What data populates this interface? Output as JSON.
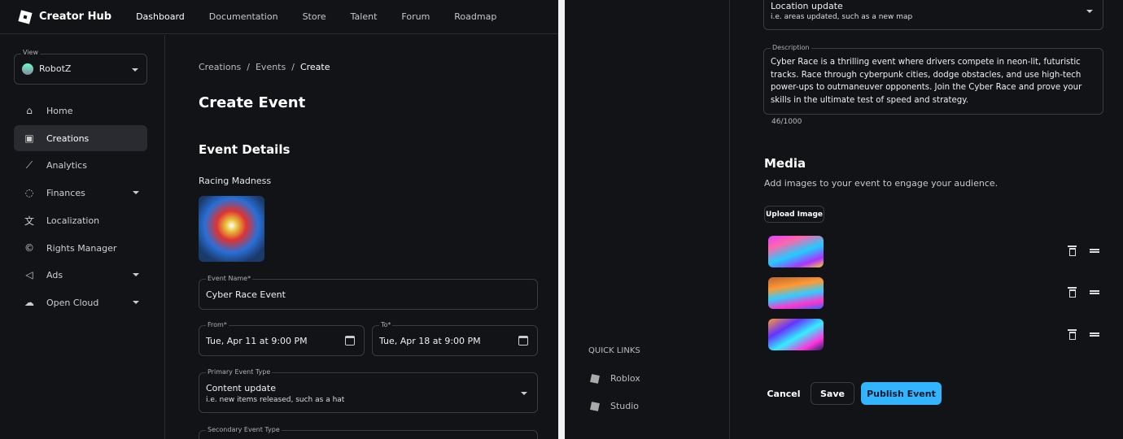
{
  "header": {
    "brand": "Creator Hub",
    "nav": [
      "Dashboard",
      "Documentation",
      "Store",
      "Talent",
      "Forum",
      "Roadmap"
    ]
  },
  "sidebar": {
    "view_label": "View",
    "view_value": "RobotZ",
    "items": [
      {
        "label": "Home",
        "icon": "home-icon"
      },
      {
        "label": "Creations",
        "icon": "creations-icon"
      },
      {
        "label": "Analytics",
        "icon": "analytics-icon"
      },
      {
        "label": "Finances",
        "icon": "piggy-bank-icon"
      },
      {
        "label": "Localization",
        "icon": "translate-icon"
      },
      {
        "label": "Rights Manager",
        "icon": "copyright-icon"
      },
      {
        "label": "Ads",
        "icon": "megaphone-icon"
      },
      {
        "label": "Open Cloud",
        "icon": "cloud-icon"
      }
    ],
    "quick_links_title": "QUICK LINKS",
    "quick_links": [
      "Roblox",
      "Studio"
    ]
  },
  "breadcrumb": [
    "Creations",
    "Events",
    "Create"
  ],
  "page_title": "Create Event",
  "details": {
    "title": "Event Details",
    "experience_name": "Racing Madness",
    "event_name_label": "Event Name*",
    "event_name": "Cyber Race Event",
    "from_label": "From*",
    "from": "Tue, Apr 11 at 9:00 PM",
    "to_label": "To*",
    "to": "Tue, Apr 18 at 9:00 PM",
    "primary_label": "Primary Event Type",
    "primary_value": "Content update",
    "primary_hint": "i.e. new items released, such as a hat",
    "secondary_label": "Secondary Event Type",
    "secondary_value": "Location update",
    "secondary_hint": "i.e. areas updated, such as a new map",
    "description_label": "Description",
    "description": "Cyber Race is a thrilling event where drivers compete in neon-lit, futuristic tracks. Race through cyberpunk cities, dodge obstacles, and use high-tech power-ups to outmaneuver opponents. Join the Cyber Race and prove your skills in the ultimate test of speed and strategy.",
    "char_count": "46/1000"
  },
  "media": {
    "title": "Media",
    "subtitle": "Add images to your event to engage your audience.",
    "upload_label": "Upload Image",
    "image_count": 3
  },
  "actions": {
    "cancel": "Cancel",
    "save": "Save",
    "publish": "Publish Event"
  },
  "colors": {
    "accent": "#33b4ff",
    "bg": "#121317"
  }
}
